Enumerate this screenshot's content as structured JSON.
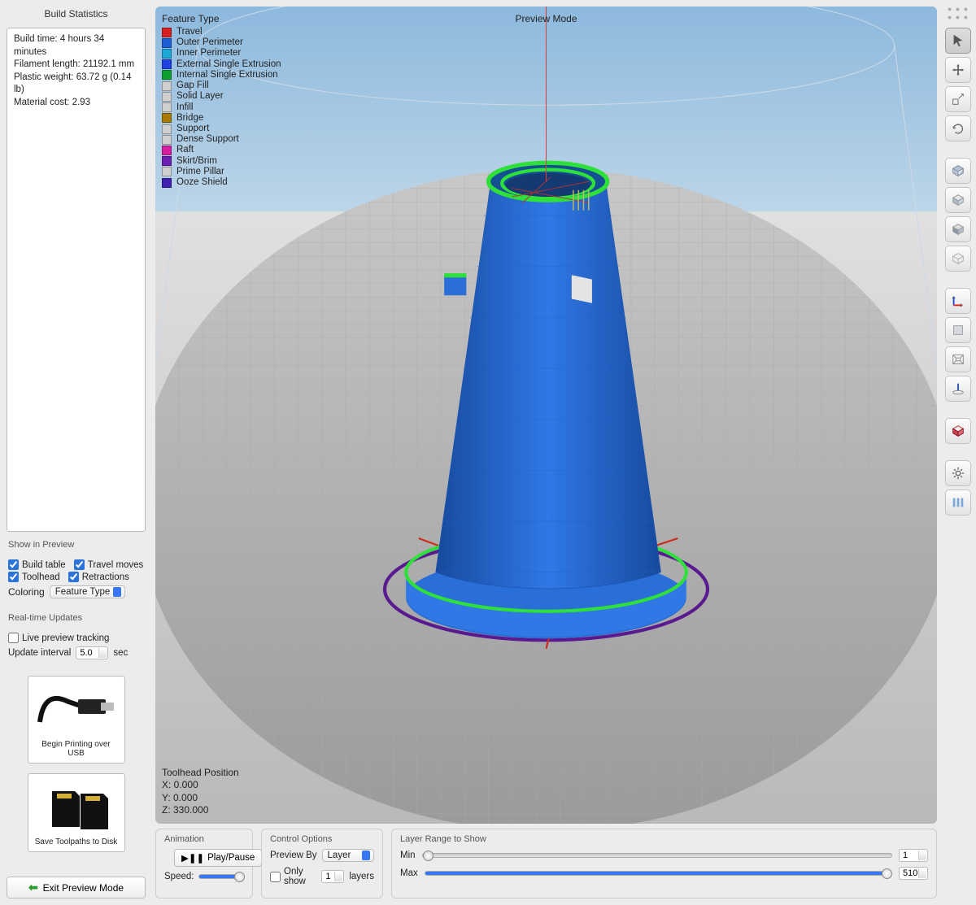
{
  "sidebar": {
    "stats_title": "Build Statistics",
    "stats_lines": {
      "l0": "Build time: 4 hours 34 minutes",
      "l1": "Filament length: 21192.1 mm",
      "l2": "Plastic weight: 63.72 g (0.14 lb)",
      "l3": "Material cost: 2.93"
    },
    "show_in_preview_label": "Show in Preview",
    "checks": {
      "build_table": "Build table",
      "travel_moves": "Travel moves",
      "toolhead": "Toolhead",
      "retractions": "Retractions"
    },
    "coloring_label": "Coloring",
    "coloring_value": "Feature Type",
    "updates_label": "Real-time Updates",
    "live_preview": "Live preview tracking",
    "update_interval_label": "Update interval",
    "update_interval_value": "5.0",
    "sec_label": "sec",
    "usb_label": "Begin Printing over USB",
    "disk_label": "Save Toolpaths to Disk",
    "exit_label": "Exit Preview Mode"
  },
  "viewport": {
    "legend_title": "Feature Type",
    "legend": [
      {
        "color": "#d61f1f",
        "label": "Travel"
      },
      {
        "color": "#1f5fd6",
        "label": "Outer Perimeter"
      },
      {
        "color": "#1fa7d6",
        "label": "Inner Perimeter"
      },
      {
        "color": "#2040e0",
        "label": "External Single Extrusion"
      },
      {
        "color": "#0f9f2f",
        "label": "Internal Single Extrusion"
      },
      {
        "color": "#cfcfcf",
        "label": "Gap Fill"
      },
      {
        "color": "#cfcfcf",
        "label": "Solid Layer"
      },
      {
        "color": "#cfcfcf",
        "label": "Infill"
      },
      {
        "color": "#a87b00",
        "label": "Bridge"
      },
      {
        "color": "#cfcfcf",
        "label": "Support"
      },
      {
        "color": "#cfcfcf",
        "label": "Dense Support"
      },
      {
        "color": "#d61f9f",
        "label": "Raft"
      },
      {
        "color": "#6a1fb0",
        "label": "Skirt/Brim"
      },
      {
        "color": "#cfcfcf",
        "label": "Prime Pillar"
      },
      {
        "color": "#3f1fb0",
        "label": "Ooze Shield"
      }
    ],
    "preview_mode": "Preview Mode",
    "toolhead_title": "Toolhead Position",
    "x": "X: 0.000",
    "y": "Y: 0.000",
    "z": "Z: 330.000"
  },
  "bottom": {
    "animation": "Animation",
    "play_pause": "Play/Pause",
    "speed": "Speed:",
    "control": "Control Options",
    "preview_by": "Preview By",
    "preview_by_value": "Layer",
    "only_show": "Only show",
    "only_show_value": "1",
    "layers": "layers",
    "range": "Layer Range to Show",
    "min": "Min",
    "min_value": "1",
    "max": "Max",
    "max_value": "510"
  },
  "tools": {
    "t0": "cursor-icon",
    "t1": "move-icon",
    "t2": "scale-icon",
    "t3": "rotate-icon",
    "t4": "cube-iso-icon",
    "t5": "cube-front-icon",
    "t6": "cube-shaded-icon",
    "t7": "cube-empty-icon",
    "t8": "axes-icon",
    "t9": "ortho-icon",
    "t10": "persp-icon",
    "t11": "ground-icon",
    "t12": "model-icon",
    "t13": "gear-icon",
    "t14": "columns-icon"
  }
}
